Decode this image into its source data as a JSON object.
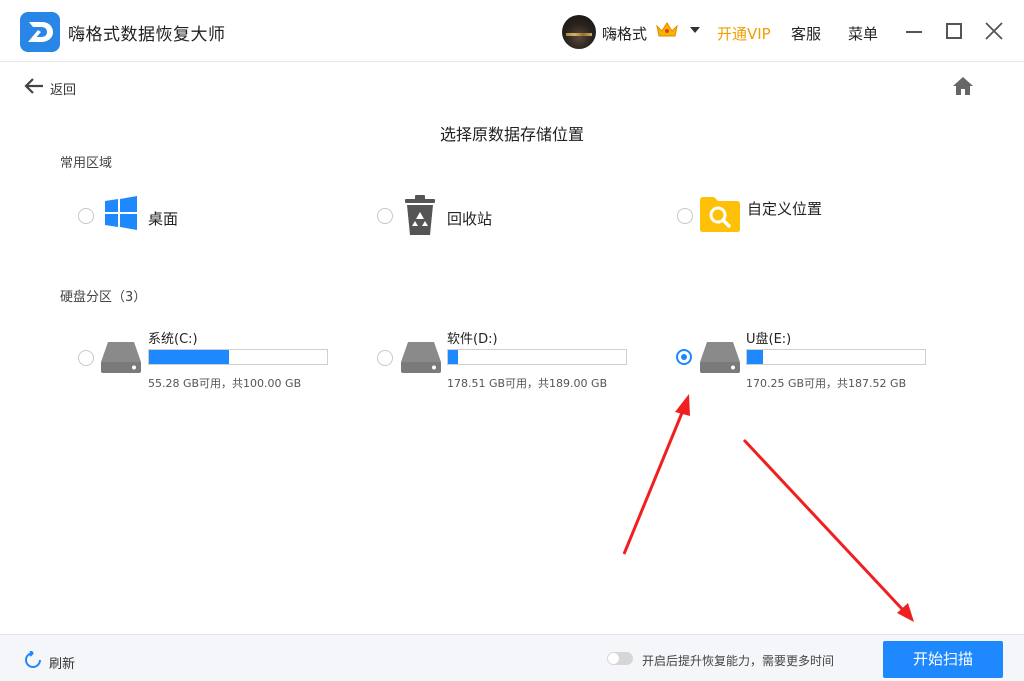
{
  "app": {
    "title": "嗨格式数据恢复大师",
    "username": "嗨格式",
    "vip_label": "开通VIP",
    "service_label": "客服",
    "menu_label": "菜单"
  },
  "nav": {
    "back_label": "返回"
  },
  "page": {
    "title": "选择原数据存储位置"
  },
  "common": {
    "section_label": "常用区域",
    "items": [
      {
        "label": "桌面",
        "icon": "windows-icon",
        "selected": false
      },
      {
        "label": "回收站",
        "icon": "recycle-bin-icon",
        "selected": false
      },
      {
        "label": "自定义位置",
        "icon": "folder-search-icon",
        "selected": false
      }
    ]
  },
  "drives": {
    "section_label": "硬盘分区（3）",
    "items": [
      {
        "name": "系统(C:)",
        "info": "55.28 GB可用，共100.00 GB",
        "used_fraction": 0.447,
        "selected": false
      },
      {
        "name": "软件(D:)",
        "info": "178.51 GB可用，共189.00 GB",
        "used_fraction": 0.055,
        "selected": false
      },
      {
        "name": "U盘(E:)",
        "info": "170.25 GB可用，共187.52 GB",
        "used_fraction": 0.092,
        "selected": true
      }
    ]
  },
  "footer": {
    "refresh_label": "刷新",
    "toggle_label": "开启后提升恢复能力，需要更多时间",
    "toggle_on": false,
    "scan_label": "开始扫描"
  },
  "colors": {
    "accent": "#1e88ff",
    "vip": "#f0a000",
    "arrow": "#f02020"
  }
}
